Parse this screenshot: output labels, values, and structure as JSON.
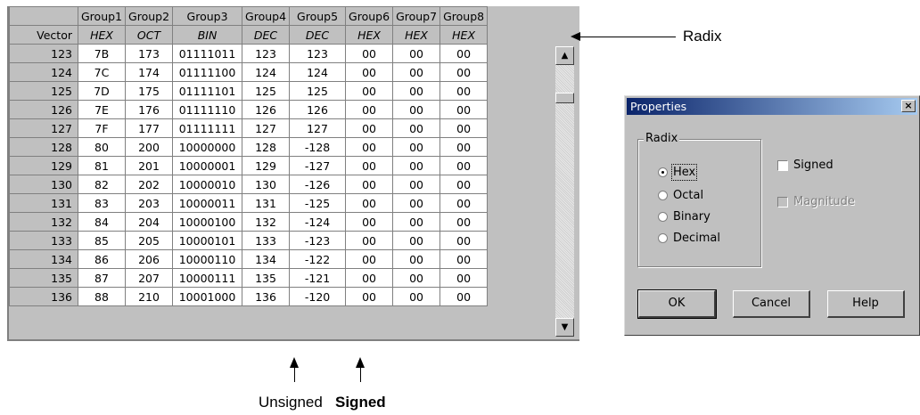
{
  "grid": {
    "corner": "",
    "groups": [
      "Group1",
      "Group2",
      "Group3",
      "Group4",
      "Group5",
      "Group6",
      "Group7",
      "Group8"
    ],
    "radix_label": "Vector",
    "radixes": [
      "HEX",
      "OCT",
      "BIN",
      "DEC",
      "DEC",
      "HEX",
      "HEX",
      "HEX"
    ],
    "rows": [
      {
        "vector": "123",
        "values": [
          "7B",
          "173",
          "01111011",
          "123",
          "123",
          "00",
          "00",
          "00"
        ]
      },
      {
        "vector": "124",
        "values": [
          "7C",
          "174",
          "01111100",
          "124",
          "124",
          "00",
          "00",
          "00"
        ]
      },
      {
        "vector": "125",
        "values": [
          "7D",
          "175",
          "01111101",
          "125",
          "125",
          "00",
          "00",
          "00"
        ]
      },
      {
        "vector": "126",
        "values": [
          "7E",
          "176",
          "01111110",
          "126",
          "126",
          "00",
          "00",
          "00"
        ]
      },
      {
        "vector": "127",
        "values": [
          "7F",
          "177",
          "01111111",
          "127",
          "127",
          "00",
          "00",
          "00"
        ]
      },
      {
        "vector": "128",
        "values": [
          "80",
          "200",
          "10000000",
          "128",
          "-128",
          "00",
          "00",
          "00"
        ]
      },
      {
        "vector": "129",
        "values": [
          "81",
          "201",
          "10000001",
          "129",
          "-127",
          "00",
          "00",
          "00"
        ]
      },
      {
        "vector": "130",
        "values": [
          "82",
          "202",
          "10000010",
          "130",
          "-126",
          "00",
          "00",
          "00"
        ]
      },
      {
        "vector": "131",
        "values": [
          "83",
          "203",
          "10000011",
          "131",
          "-125",
          "00",
          "00",
          "00"
        ]
      },
      {
        "vector": "132",
        "values": [
          "84",
          "204",
          "10000100",
          "132",
          "-124",
          "00",
          "00",
          "00"
        ]
      },
      {
        "vector": "133",
        "values": [
          "85",
          "205",
          "10000101",
          "133",
          "-123",
          "00",
          "00",
          "00"
        ]
      },
      {
        "vector": "134",
        "values": [
          "86",
          "206",
          "10000110",
          "134",
          "-122",
          "00",
          "00",
          "00"
        ]
      },
      {
        "vector": "135",
        "values": [
          "87",
          "207",
          "10000111",
          "135",
          "-121",
          "00",
          "00",
          "00"
        ]
      },
      {
        "vector": "136",
        "values": [
          "88",
          "210",
          "10001000",
          "136",
          "-120",
          "00",
          "00",
          "00"
        ]
      }
    ],
    "scroll_up_icon": "▲",
    "scroll_down_icon": "▼"
  },
  "annotations": {
    "radix": "Radix",
    "unsigned": "Unsigned",
    "signed": "Signed"
  },
  "dialog": {
    "title": "Properties",
    "close_icon": "×",
    "radix_group_label": "Radix",
    "radix_options": [
      {
        "label": "Hex",
        "selected": true
      },
      {
        "label": "Octal",
        "selected": false
      },
      {
        "label": "Binary",
        "selected": false
      },
      {
        "label": "Decimal",
        "selected": false
      }
    ],
    "signed_label": "Signed",
    "magnitude_label": "Magnitude",
    "ok_label": "OK",
    "cancel_label": "Cancel",
    "help_label": "Help"
  }
}
